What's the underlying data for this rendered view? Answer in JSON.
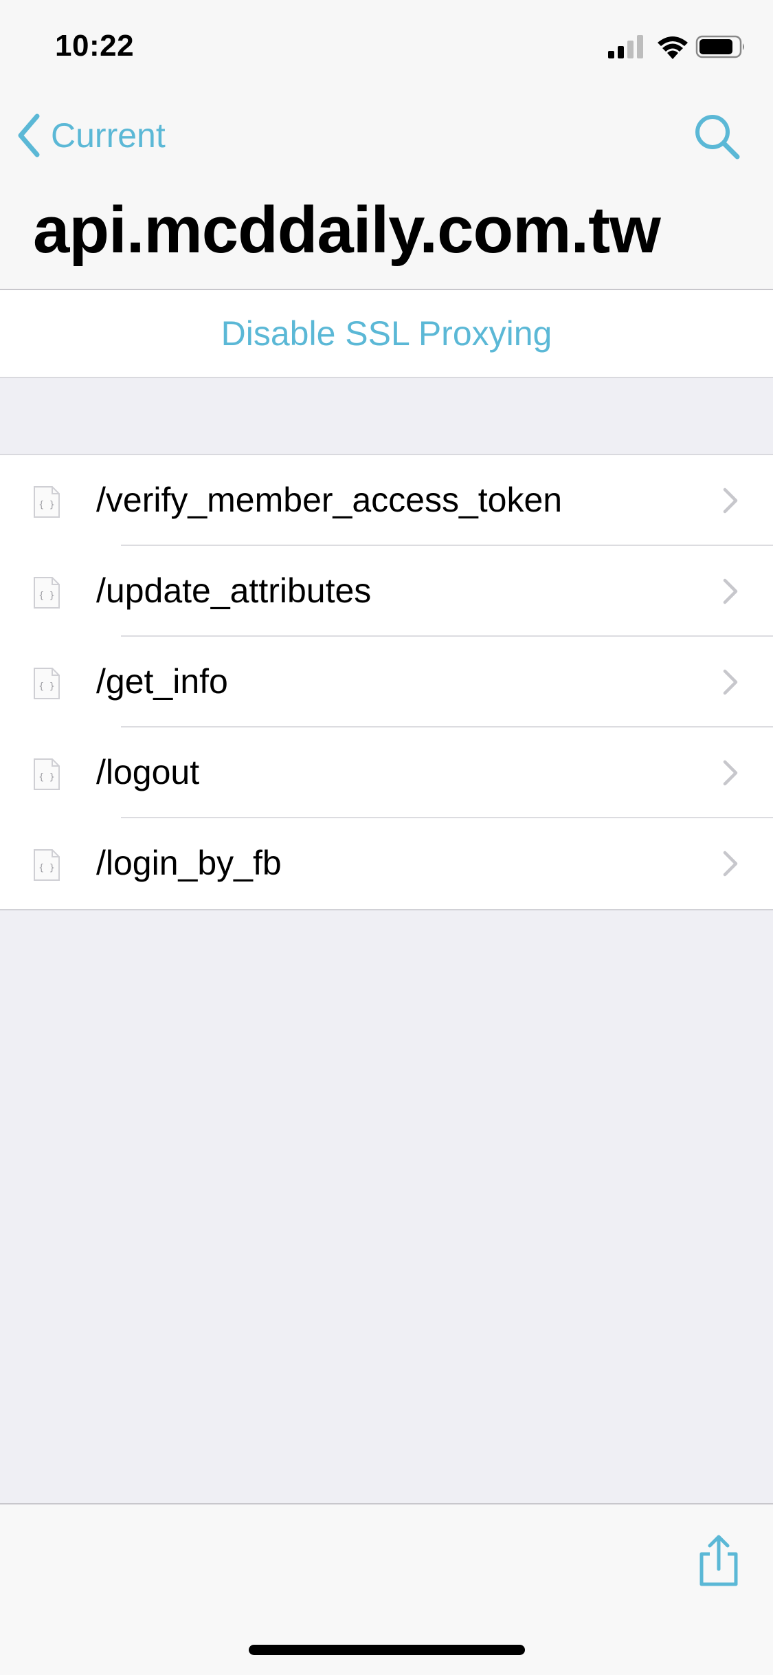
{
  "status_bar": {
    "time": "10:22"
  },
  "nav": {
    "back_label": "Current",
    "title": "api.mcddaily.com.tw"
  },
  "ssl": {
    "label": "Disable SSL Proxying"
  },
  "endpoints": [
    {
      "path": "/verify_member_access_token"
    },
    {
      "path": "/update_attributes"
    },
    {
      "path": "/get_info"
    },
    {
      "path": "/logout"
    },
    {
      "path": "/login_by_fb"
    }
  ],
  "colors": {
    "accent": "#5bb8d6",
    "background": "#efeff4",
    "chevron": "#c7c7cc"
  },
  "icons": {
    "back": "chevron-left-icon",
    "search": "search-icon",
    "file": "json-file-icon",
    "row_disclosure": "chevron-right-icon",
    "share": "share-icon"
  }
}
